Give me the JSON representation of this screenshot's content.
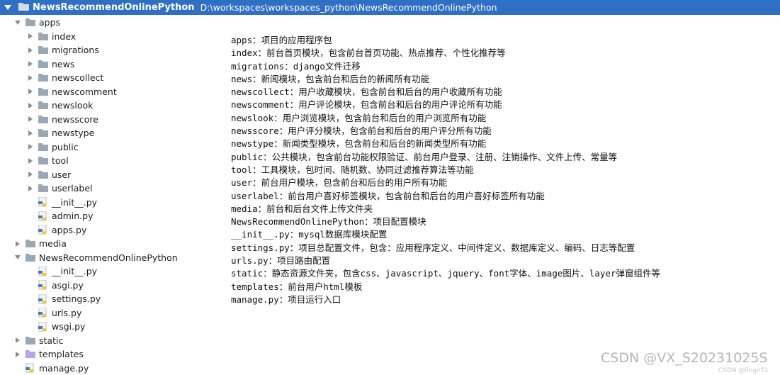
{
  "header": {
    "project_name": "NewsRecommendOnlinePython",
    "project_path": "D:\\workspaces\\workspaces_python\\NewsRecommendOnlinePython"
  },
  "tree": [
    {
      "label": "apps",
      "type": "folder",
      "state": "expanded",
      "level": 1
    },
    {
      "label": "index",
      "type": "folder",
      "state": "collapsed",
      "level": 2
    },
    {
      "label": "migrations",
      "type": "folder",
      "state": "collapsed",
      "level": 2
    },
    {
      "label": "news",
      "type": "folder",
      "state": "collapsed",
      "level": 2
    },
    {
      "label": "newscollect",
      "type": "folder",
      "state": "collapsed",
      "level": 2
    },
    {
      "label": "newscomment",
      "type": "folder",
      "state": "collapsed",
      "level": 2
    },
    {
      "label": "newslook",
      "type": "folder",
      "state": "collapsed",
      "level": 2
    },
    {
      "label": "newsscore",
      "type": "folder",
      "state": "collapsed",
      "level": 2
    },
    {
      "label": "newstype",
      "type": "folder",
      "state": "collapsed",
      "level": 2
    },
    {
      "label": "public",
      "type": "folder",
      "state": "collapsed",
      "level": 2
    },
    {
      "label": "tool",
      "type": "folder",
      "state": "collapsed",
      "level": 2
    },
    {
      "label": "user",
      "type": "folder",
      "state": "collapsed",
      "level": 2
    },
    {
      "label": "userlabel",
      "type": "folder",
      "state": "collapsed",
      "level": 2
    },
    {
      "label": "__init__.py",
      "type": "file",
      "state": "none",
      "level": 2
    },
    {
      "label": "admin.py",
      "type": "file",
      "state": "none",
      "level": 2
    },
    {
      "label": "apps.py",
      "type": "file",
      "state": "none",
      "level": 2
    },
    {
      "label": "media",
      "type": "folder",
      "state": "collapsed",
      "level": 1
    },
    {
      "label": "NewsRecommendOnlinePython",
      "type": "folder",
      "state": "expanded",
      "level": 1
    },
    {
      "label": "__init__.py",
      "type": "file",
      "state": "none",
      "level": 2
    },
    {
      "label": "asgi.py",
      "type": "file",
      "state": "none",
      "level": 2
    },
    {
      "label": "settings.py",
      "type": "file",
      "state": "none",
      "level": 2
    },
    {
      "label": "urls.py",
      "type": "file",
      "state": "none",
      "level": 2
    },
    {
      "label": "wsgi.py",
      "type": "file",
      "state": "none",
      "level": 2
    },
    {
      "label": "static",
      "type": "folder",
      "state": "collapsed",
      "level": 1
    },
    {
      "label": "templates",
      "type": "folder-purple",
      "state": "collapsed",
      "level": 1
    },
    {
      "label": "manage.py",
      "type": "file",
      "state": "none",
      "level": 1
    }
  ],
  "notes": [
    "apps：项目的应用程序包",
    "index：前台首页模块，包含前台首页功能、热点推荐、个性化推荐等",
    "migrations：django文件迁移",
    "news：新闻模块，包含前台和后台的新闻所有功能",
    "newscollect：用户收藏模块，包含前台和后台的用户收藏所有功能",
    "newscomment：用户评论模块，包含前台和后台的用户评论所有功能",
    "newslook：用户浏览模块，包含前台和后台的用户浏览所有功能",
    "newsscore：用户评分模块，包含前台和后台的用户评分所有功能",
    "newstype：新闻类型模块，包含前台和后台的新闻类型所有功能",
    "public：公共模块，包含前台功能权限验证、前台用户登录、注册、注销操作、文件上传、常量等",
    "tool：工具模块，包时间、随机数、协同过滤推荐算法等功能",
    "user：前台用户模块，包含前台和后台的用户所有功能",
    "userlabel：前台用户喜好标签模块，包含前台和后台的用户喜好标签所有功能",
    "media：前台和后台文件上传文件夹",
    "NewsRecommendOnlinePython：项目配置模块",
    "__init__.py：mysql数据库模块配置",
    "settings.py：项目总配置文件，包含：应用程序定义、中间件定义、数据库定义、编码、日志等配置",
    "urls.py：项目路由配置",
    "static：静态资源文件夹，包含css、javascript、jquery、font字体、image图片、layer弹窗组件等",
    "templates：前台用户html模板",
    "manage.py：项目运行入口"
  ],
  "watermark": "CSDN @VX_S20231025S",
  "watermark_small": "CSDN @lingo51",
  "colors": {
    "header_bg": "#2f6fc4",
    "folder": "#9aa7b4",
    "folder_purple": "#b9a6e6"
  }
}
